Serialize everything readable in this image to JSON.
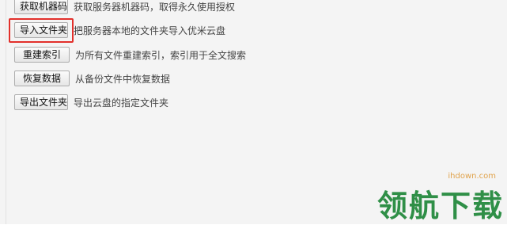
{
  "actions": [
    {
      "button": "获取机器码",
      "description": "获取服务器机器码，取得永久使用授权"
    },
    {
      "button": "导入文件夹",
      "description": "把服务器本地的文件夹导入优米云盘"
    },
    {
      "button": "重建索引",
      "description": "为所有文件重建索引，索引用于全文搜索"
    },
    {
      "button": "恢复数据",
      "description": "从备份文件中恢复数据"
    },
    {
      "button": "导出文件夹",
      "description": "导出云盘的指定文件夹"
    }
  ],
  "watermark": {
    "site": "ihdown.com",
    "logo": "领航下载"
  },
  "colors": {
    "highlight": "#e2302b",
    "watermark_logo": "#2f8f47",
    "watermark_site": "#e0a24a"
  }
}
